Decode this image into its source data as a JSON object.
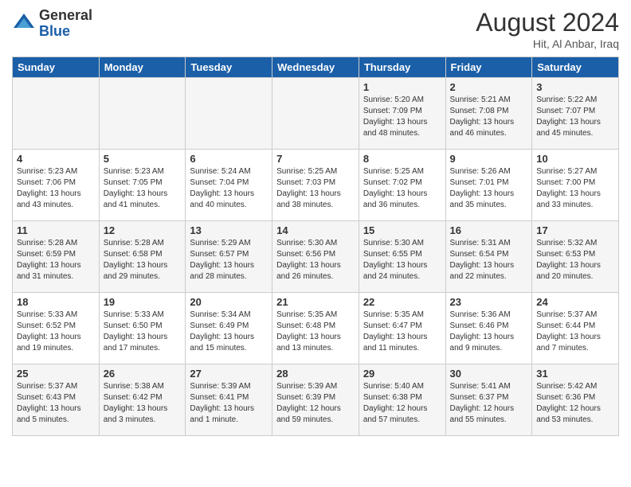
{
  "logo": {
    "general": "General",
    "blue": "Blue"
  },
  "title": {
    "month_year": "August 2024",
    "location": "Hit, Al Anbar, Iraq"
  },
  "days_of_week": [
    "Sunday",
    "Monday",
    "Tuesday",
    "Wednesday",
    "Thursday",
    "Friday",
    "Saturday"
  ],
  "weeks": [
    [
      {
        "day": "",
        "info": ""
      },
      {
        "day": "",
        "info": ""
      },
      {
        "day": "",
        "info": ""
      },
      {
        "day": "",
        "info": ""
      },
      {
        "day": "1",
        "info": "Sunrise: 5:20 AM\nSunset: 7:09 PM\nDaylight: 13 hours\nand 48 minutes."
      },
      {
        "day": "2",
        "info": "Sunrise: 5:21 AM\nSunset: 7:08 PM\nDaylight: 13 hours\nand 46 minutes."
      },
      {
        "day": "3",
        "info": "Sunrise: 5:22 AM\nSunset: 7:07 PM\nDaylight: 13 hours\nand 45 minutes."
      }
    ],
    [
      {
        "day": "4",
        "info": "Sunrise: 5:23 AM\nSunset: 7:06 PM\nDaylight: 13 hours\nand 43 minutes."
      },
      {
        "day": "5",
        "info": "Sunrise: 5:23 AM\nSunset: 7:05 PM\nDaylight: 13 hours\nand 41 minutes."
      },
      {
        "day": "6",
        "info": "Sunrise: 5:24 AM\nSunset: 7:04 PM\nDaylight: 13 hours\nand 40 minutes."
      },
      {
        "day": "7",
        "info": "Sunrise: 5:25 AM\nSunset: 7:03 PM\nDaylight: 13 hours\nand 38 minutes."
      },
      {
        "day": "8",
        "info": "Sunrise: 5:25 AM\nSunset: 7:02 PM\nDaylight: 13 hours\nand 36 minutes."
      },
      {
        "day": "9",
        "info": "Sunrise: 5:26 AM\nSunset: 7:01 PM\nDaylight: 13 hours\nand 35 minutes."
      },
      {
        "day": "10",
        "info": "Sunrise: 5:27 AM\nSunset: 7:00 PM\nDaylight: 13 hours\nand 33 minutes."
      }
    ],
    [
      {
        "day": "11",
        "info": "Sunrise: 5:28 AM\nSunset: 6:59 PM\nDaylight: 13 hours\nand 31 minutes."
      },
      {
        "day": "12",
        "info": "Sunrise: 5:28 AM\nSunset: 6:58 PM\nDaylight: 13 hours\nand 29 minutes."
      },
      {
        "day": "13",
        "info": "Sunrise: 5:29 AM\nSunset: 6:57 PM\nDaylight: 13 hours\nand 28 minutes."
      },
      {
        "day": "14",
        "info": "Sunrise: 5:30 AM\nSunset: 6:56 PM\nDaylight: 13 hours\nand 26 minutes."
      },
      {
        "day": "15",
        "info": "Sunrise: 5:30 AM\nSunset: 6:55 PM\nDaylight: 13 hours\nand 24 minutes."
      },
      {
        "day": "16",
        "info": "Sunrise: 5:31 AM\nSunset: 6:54 PM\nDaylight: 13 hours\nand 22 minutes."
      },
      {
        "day": "17",
        "info": "Sunrise: 5:32 AM\nSunset: 6:53 PM\nDaylight: 13 hours\nand 20 minutes."
      }
    ],
    [
      {
        "day": "18",
        "info": "Sunrise: 5:33 AM\nSunset: 6:52 PM\nDaylight: 13 hours\nand 19 minutes."
      },
      {
        "day": "19",
        "info": "Sunrise: 5:33 AM\nSunset: 6:50 PM\nDaylight: 13 hours\nand 17 minutes."
      },
      {
        "day": "20",
        "info": "Sunrise: 5:34 AM\nSunset: 6:49 PM\nDaylight: 13 hours\nand 15 minutes."
      },
      {
        "day": "21",
        "info": "Sunrise: 5:35 AM\nSunset: 6:48 PM\nDaylight: 13 hours\nand 13 minutes."
      },
      {
        "day": "22",
        "info": "Sunrise: 5:35 AM\nSunset: 6:47 PM\nDaylight: 13 hours\nand 11 minutes."
      },
      {
        "day": "23",
        "info": "Sunrise: 5:36 AM\nSunset: 6:46 PM\nDaylight: 13 hours\nand 9 minutes."
      },
      {
        "day": "24",
        "info": "Sunrise: 5:37 AM\nSunset: 6:44 PM\nDaylight: 13 hours\nand 7 minutes."
      }
    ],
    [
      {
        "day": "25",
        "info": "Sunrise: 5:37 AM\nSunset: 6:43 PM\nDaylight: 13 hours\nand 5 minutes."
      },
      {
        "day": "26",
        "info": "Sunrise: 5:38 AM\nSunset: 6:42 PM\nDaylight: 13 hours\nand 3 minutes."
      },
      {
        "day": "27",
        "info": "Sunrise: 5:39 AM\nSunset: 6:41 PM\nDaylight: 13 hours\nand 1 minute."
      },
      {
        "day": "28",
        "info": "Sunrise: 5:39 AM\nSunset: 6:39 PM\nDaylight: 12 hours\nand 59 minutes."
      },
      {
        "day": "29",
        "info": "Sunrise: 5:40 AM\nSunset: 6:38 PM\nDaylight: 12 hours\nand 57 minutes."
      },
      {
        "day": "30",
        "info": "Sunrise: 5:41 AM\nSunset: 6:37 PM\nDaylight: 12 hours\nand 55 minutes."
      },
      {
        "day": "31",
        "info": "Sunrise: 5:42 AM\nSunset: 6:36 PM\nDaylight: 12 hours\nand 53 minutes."
      }
    ]
  ]
}
